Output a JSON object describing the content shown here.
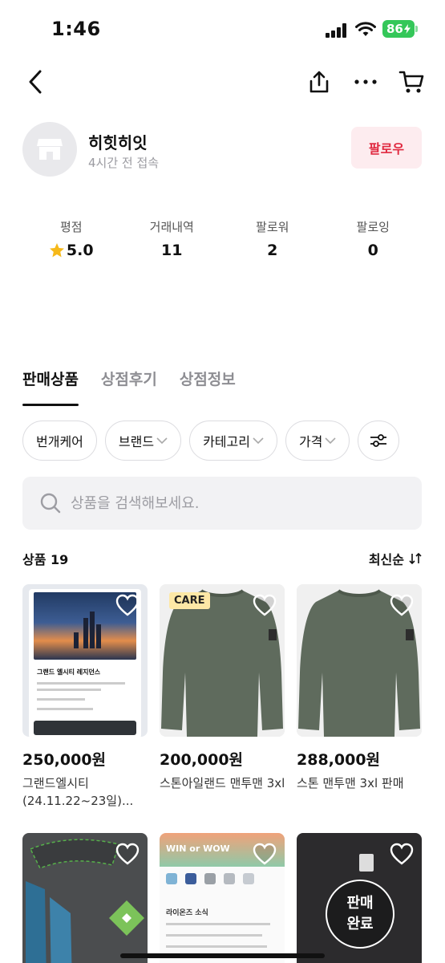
{
  "status_bar": {
    "time": "1:46",
    "battery": "86"
  },
  "nav": {
    "back_icon": "chevron-left-icon",
    "share_icon": "share-icon",
    "more_icon": "more-icon",
    "cart_icon": "cart-icon"
  },
  "profile": {
    "name": "히힛히잇",
    "last_seen": "4시간 전 접속",
    "follow_label": "팔로우"
  },
  "stats": [
    {
      "label": "평점",
      "value": "5.0",
      "icon": "star-icon"
    },
    {
      "label": "거래내역",
      "value": "11"
    },
    {
      "label": "팔로워",
      "value": "2"
    },
    {
      "label": "팔로잉",
      "value": "0"
    }
  ],
  "tabs": [
    {
      "label": "판매상품",
      "active": true
    },
    {
      "label": "상점후기",
      "active": false
    },
    {
      "label": "상점정보",
      "active": false
    }
  ],
  "filters": [
    {
      "label": "번개케어",
      "has_dropdown": false
    },
    {
      "label": "브랜드",
      "has_dropdown": true
    },
    {
      "label": "카테고리",
      "has_dropdown": true
    },
    {
      "label": "가격",
      "has_dropdown": true
    }
  ],
  "search": {
    "placeholder": "상품을 검색해보세요."
  },
  "list": {
    "count_label": "상품 19",
    "sort_label": "최신순"
  },
  "products": [
    {
      "price": "250,000원",
      "name": "그랜드엘시티 (24.11.22~23일)...",
      "image": "brochure",
      "care_badge": ""
    },
    {
      "price": "200,000원",
      "name": "스톤아일랜드 맨투맨 3xl",
      "image": "sweater",
      "care_badge": "CARE"
    },
    {
      "price": "288,000원",
      "name": "스톤 맨투맨 3xl 판매",
      "image": "sweater",
      "care_badge": ""
    },
    {
      "price": "",
      "name": "",
      "image": "stadium",
      "care_badge": ""
    },
    {
      "price": "",
      "name": "",
      "image": "news",
      "care_badge": "",
      "news_banner": "WIN or WOW",
      "news_heading": "라이온즈 소식"
    },
    {
      "price": "",
      "name": "",
      "image": "sold",
      "care_badge": "",
      "sold_label": "판매\n완료"
    }
  ],
  "brochure": {
    "title": "그랜드 엘시티 레지던스"
  },
  "colors": {
    "accent": "#e0283f",
    "follow_bg": "#fdecef",
    "battery": "#34c759",
    "star": "#f6b91a"
  }
}
